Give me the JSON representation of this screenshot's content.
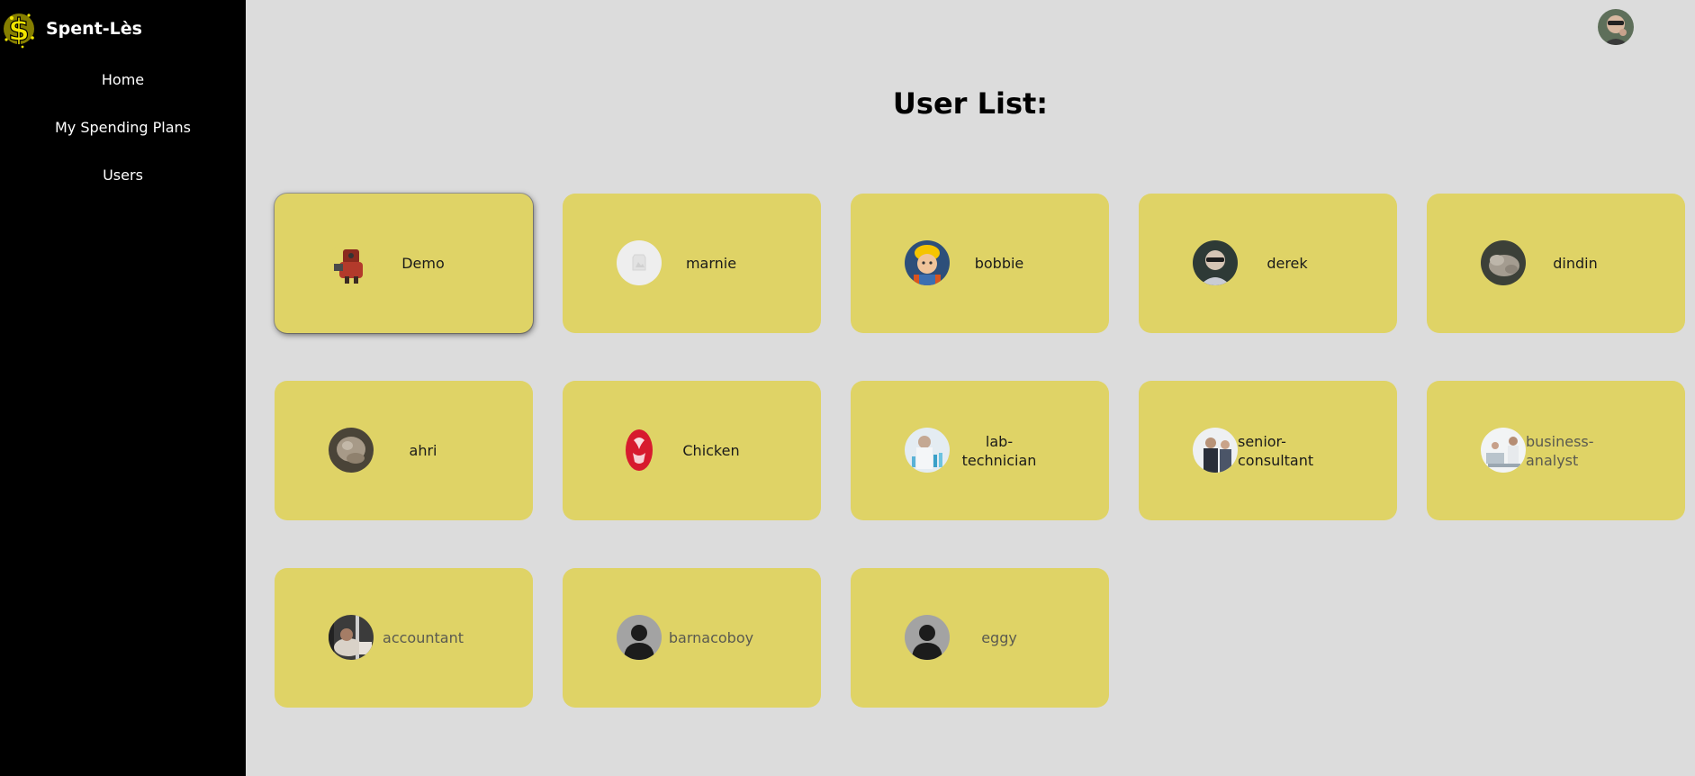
{
  "app": {
    "title": "Spent-Lès",
    "logo_icon": "dollar-logo-icon"
  },
  "nav": {
    "items": [
      {
        "label": "Home"
      },
      {
        "label": "My Spending Plans"
      },
      {
        "label": "Users"
      }
    ]
  },
  "header": {
    "title": "User List:",
    "profile_icon": "profile-avatar-icon"
  },
  "users": [
    {
      "name": "Demo",
      "avatar": "robot-character-icon"
    },
    {
      "name": "marnie",
      "avatar": "placeholder-image-icon"
    },
    {
      "name": "bobbie",
      "avatar": "builder-character-icon"
    },
    {
      "name": "derek",
      "avatar": "person-photo-icon"
    },
    {
      "name": "dindin",
      "avatar": "animal-photo-icon"
    },
    {
      "name": "ahri",
      "avatar": "animal-photo-icon"
    },
    {
      "name": "Chicken",
      "avatar": "chicken-logo-icon"
    },
    {
      "name": "lab-technician",
      "avatar": "lab-photo-icon"
    },
    {
      "name": "senior-consultant",
      "avatar": "office-photo-icon"
    },
    {
      "name": "business-analyst",
      "avatar": "office-photo-icon"
    },
    {
      "name": "accountant",
      "avatar": "office-photo-icon"
    },
    {
      "name": "barnacoboy",
      "avatar": "default-user-icon"
    },
    {
      "name": "eggy",
      "avatar": "default-user-icon"
    }
  ],
  "colors": {
    "sidebar": "#000000",
    "background": "#dcdcdc",
    "card": "#dfd366",
    "logo": "#f2e600"
  }
}
